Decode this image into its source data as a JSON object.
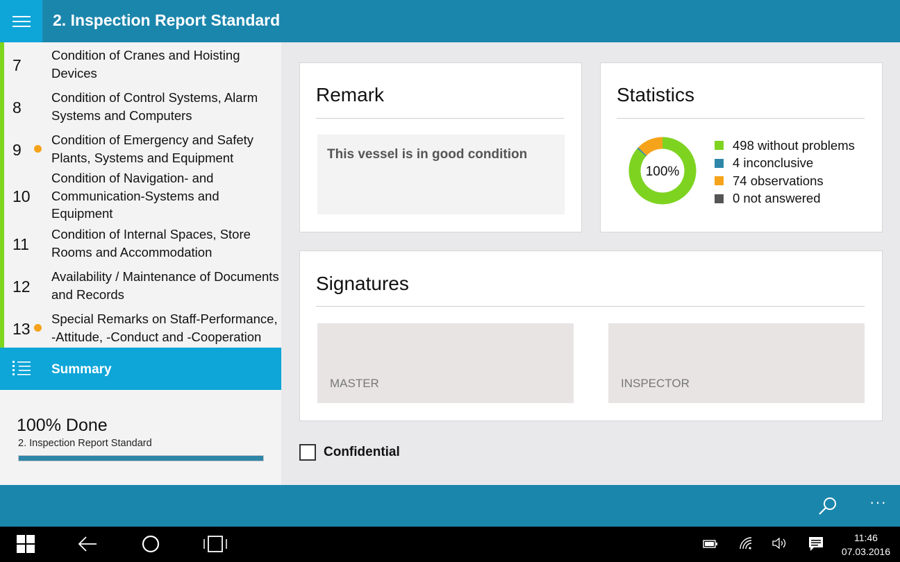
{
  "header": {
    "title": "2. Inspection Report Standard"
  },
  "sidebar": {
    "items": [
      {
        "num": "7",
        "label": "Condition of Cranes and Hoisting Devices",
        "dot": false
      },
      {
        "num": "8",
        "label": "Condition of Control Systems, Alarm Systems and Computers",
        "dot": false
      },
      {
        "num": "9",
        "label": "Condition of Emergency and Safety Plants, Systems and Equipment",
        "dot": true
      },
      {
        "num": "10",
        "label": "Condition of Navigation- and Communication-Systems and Equipment",
        "dot": false
      },
      {
        "num": "11",
        "label": "Condition of Internal Spaces, Store Rooms and Accommodation",
        "dot": false
      },
      {
        "num": "12",
        "label": "Availability / Maintenance of Documents and Records",
        "dot": false
      },
      {
        "num": "13",
        "label": "Special Remarks on Staff-Performance, -Attitude, -Conduct and -Cooperation",
        "dot": true
      }
    ],
    "summary_label": "Summary",
    "progress": {
      "title": "100% Done",
      "subtitle": "2. Inspection Report Standard",
      "value": 1.0
    }
  },
  "remark": {
    "title": "Remark",
    "text": "This vessel is in good condition"
  },
  "statistics": {
    "title": "Statistics",
    "center_label": "100%",
    "legend": [
      {
        "label": "498 without problems",
        "value": 498,
        "color": "#7ed321"
      },
      {
        "label": "4 inconclusive",
        "value": 4,
        "color": "#2e86a8"
      },
      {
        "label": "74 observations",
        "value": 74,
        "color": "#f5a31a"
      },
      {
        "label": "0 not answered",
        "value": 0,
        "color": "#555555"
      }
    ]
  },
  "signatures": {
    "title": "Signatures",
    "master_label": "MASTER",
    "inspector_label": "INSPECTOR"
  },
  "confidential_label": "Confidential",
  "taskbar": {
    "time": "11:46",
    "date": "07.03.2016"
  },
  "colors": {
    "header": "#1b86ac",
    "accent": "#0ea5d8",
    "done_bar": "#7ed61f"
  }
}
